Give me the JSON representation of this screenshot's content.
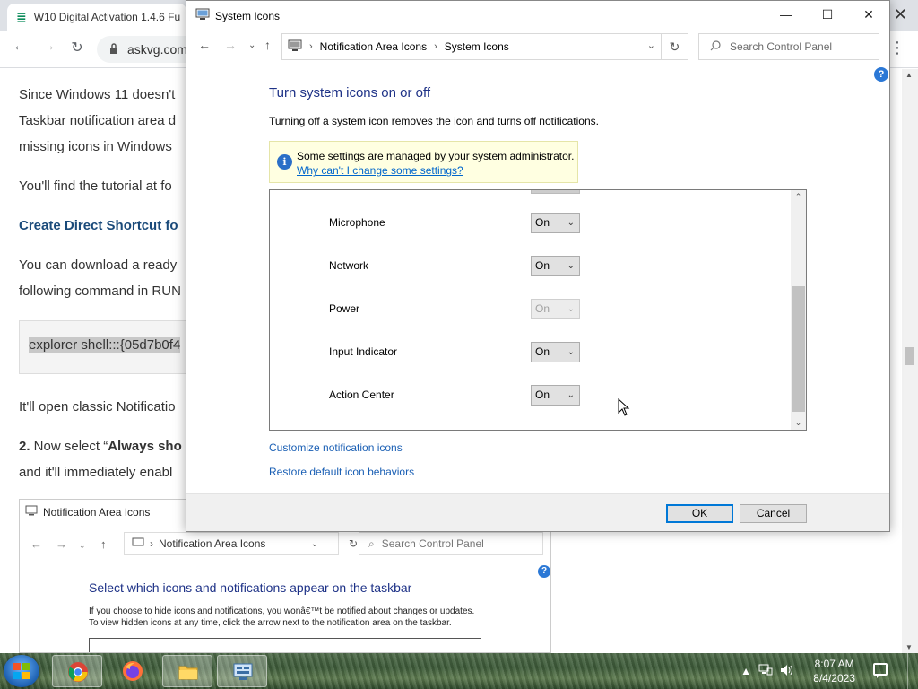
{
  "browser": {
    "tab_title": "W10 Digital Activation 1.4.6 Fu",
    "address": "askvg.com",
    "article": {
      "p1_l1": "Since Windows 11 doesn't",
      "p1_l2": "Taskbar notification area d",
      "p1_l3": "missing icons in Windows",
      "p2": "You'll find the tutorial at fo",
      "link": "Create Direct Shortcut fo",
      "p3_l1": "You can download a ready",
      "p3_l2": "following command in RUN",
      "code": "explorer shell:::{05d7b0f4",
      "p4": "It'll open classic Notificatio",
      "p5_num": "2.",
      "p5_l1_a": " Now select “",
      "p5_l1_b": "Always sho",
      "p5_l2": "and it'll immediately enabl"
    },
    "embedded": {
      "title": "Notification Area Icons",
      "address": "Notification Area Icons",
      "search_placeholder": "Search Control Panel",
      "heading": "Select which icons and notifications appear on the taskbar",
      "desc_l1": "If you choose to hide icons and notifications, you wonâ€™t be notified about changes or updates.",
      "desc_l2": "To view hidden icons at any time, click the arrow next to the notification area on the taskbar."
    }
  },
  "dialog": {
    "title": "System Icons",
    "breadcrumb": [
      "Notification Area Icons",
      "System Icons"
    ],
    "search_placeholder": "Search Control Panel",
    "help": "?",
    "heading": "Turn system icons on or off",
    "description": "Turning off a system icon removes the icon and turns off notifications.",
    "admin_notice": "Some settings are managed by your system administrator.",
    "admin_link": "Why can't I change some settings?",
    "rows": [
      {
        "name": "Microphone",
        "value": "On",
        "disabled": false
      },
      {
        "name": "Network",
        "value": "On",
        "disabled": false
      },
      {
        "name": "Power",
        "value": "On",
        "disabled": true
      },
      {
        "name": "Input Indicator",
        "value": "On",
        "disabled": false
      },
      {
        "name": "Action Center",
        "value": "On",
        "disabled": false
      }
    ],
    "link_customize": "Customize notification icons",
    "link_restore": "Restore default icon behaviors",
    "ok_label": "OK",
    "cancel_label": "Cancel"
  },
  "taskbar": {
    "time": "8:07 AM",
    "date": "8/4/2023",
    "apps": [
      "chrome",
      "firefox",
      "file-explorer",
      "control-panel"
    ]
  },
  "colors": {
    "heading_blue": "#1e3287",
    "link_blue": "#1a5fb4",
    "accent": "#0078d7",
    "notice_bg": "#ffffe1"
  }
}
